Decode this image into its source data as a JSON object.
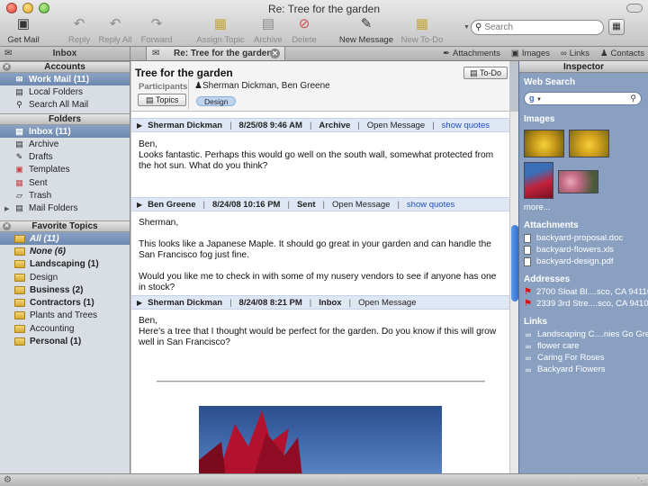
{
  "window": {
    "title": "Re: Tree for the garden"
  },
  "toolbar": {
    "get_mail": "Get Mail",
    "reply": "Reply",
    "reply_all": "Reply All",
    "forward": "Forward",
    "assign_topic": "Assign Topic",
    "archive": "Archive",
    "delete": "Delete",
    "new_message": "New Message",
    "new_todo": "New To-Do",
    "search_placeholder": "Search"
  },
  "tabs": {
    "inbox": "Inbox",
    "active": "Re: Tree for the garden",
    "attachments": "Attachments",
    "images": "Images",
    "links": "Links",
    "contacts": "Contacts"
  },
  "sidebar": {
    "accounts_title": "Accounts",
    "accounts": [
      "Work Mail (11)",
      "Local Folders",
      "Search All Mail"
    ],
    "folders_title": "Folders",
    "folders": [
      "Inbox (11)",
      "Archive",
      "Drafts",
      "Templates",
      "Sent",
      "Trash",
      "Mail Folders"
    ],
    "topics_title": "Favorite Topics",
    "topics": [
      "All (11)",
      "None (6)",
      "Landscaping (1)",
      "Design",
      "Business (2)",
      "Contractors (1)",
      "Plants and Trees",
      "Accounting",
      "Personal (1)"
    ]
  },
  "thread": {
    "subject": "Tree for the garden",
    "todo_label": "To-Do",
    "participants_label": "Participants",
    "participants": "Sherman Dickman, Ben Greene",
    "topics_button": "Topics",
    "topic_tag": "Design",
    "messages": [
      {
        "sender": "Sherman Dickman",
        "date": "8/25/08 9:46 AM",
        "folder": "Archive",
        "open": "Open Message",
        "quotes": "show quotes",
        "body": [
          "Ben,",
          "Looks fantastic.  Perhaps this would go well on the south wall, somewhat protected from the hot sun.  What do you think?"
        ]
      },
      {
        "sender": "Ben Greene",
        "date": "8/24/08 10:16 PM",
        "folder": "Sent",
        "open": "Open Message",
        "quotes": "show quotes",
        "body": [
          "Sherman,",
          "This looks like a Japanese Maple. It should go great in your garden and can handle the San Francisco fog just fine.",
          "Would you like me to check in with some of my nusery vendors to see if anyone has one in stock?"
        ]
      },
      {
        "sender": "Sherman Dickman",
        "date": "8/24/08 8:21 PM",
        "folder": "Inbox",
        "open": "Open Message",
        "body": [
          "Ben,",
          "Here's a tree that I thought would be perfect for the garden.  Do you know if this will grow well in San Francisco?"
        ]
      }
    ]
  },
  "inspector": {
    "title": "Inspector",
    "web_search": "Web Search",
    "images": "Images",
    "more": "more...",
    "attachments_title": "Attachments",
    "attachments": [
      "backyard-proposal.doc",
      "backyard-flowers.xls",
      "backyard-design.pdf"
    ],
    "addresses_title": "Addresses",
    "addresses": [
      "2700 Sloat Bl....sco, CA 94116",
      "2339 3rd Stre....sco, CA 94107"
    ],
    "links_title": "Links",
    "links": [
      "Landscaping C....nies Go Green",
      "flower care",
      "Caring For Roses",
      "Backyard Flowers"
    ]
  }
}
